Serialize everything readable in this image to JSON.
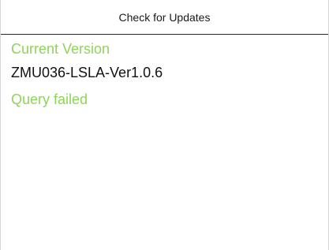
{
  "window": {
    "title": "Check for Updates"
  },
  "version_info": {
    "label": "Current Version",
    "value": "ZMU036-LSLA-Ver1.0.6"
  },
  "status": {
    "text": "Query failed"
  },
  "colors": {
    "accent_green": "#8ed45a",
    "text_dark": "#111111",
    "divider": "#2a2a2a"
  }
}
